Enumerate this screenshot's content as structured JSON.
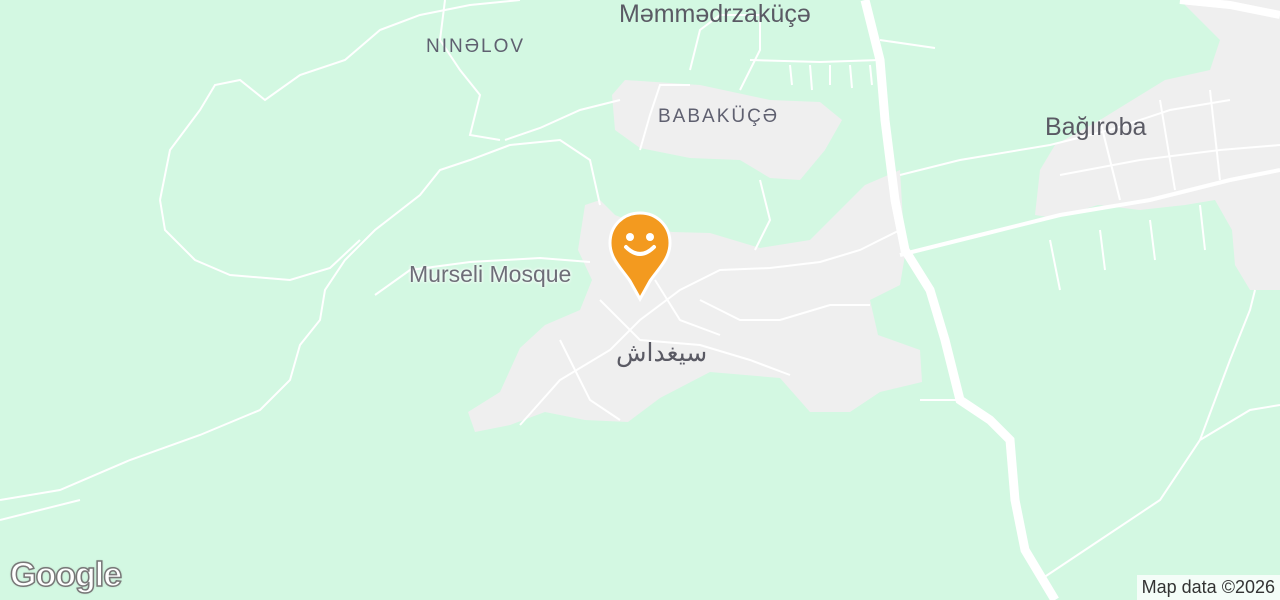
{
  "map": {
    "labels": {
      "ninelov": "NINƏLOV",
      "memmedrzakuce": "Məmmədrzaküçə",
      "babakuce": "BABAKÜÇƏ",
      "bagiroba": "Bağıroba",
      "siyadas": "سیغداش",
      "mosque": "Murseli Mosque"
    },
    "marker": {
      "icon": "smiley-face-pin-icon",
      "color": "#f39a1f"
    },
    "colors": {
      "land": "#d3f8e2",
      "settlement": "#efefef",
      "road": "#ffffff"
    }
  },
  "footer": {
    "logo": "Google",
    "attribution": "Map data ©2026"
  }
}
